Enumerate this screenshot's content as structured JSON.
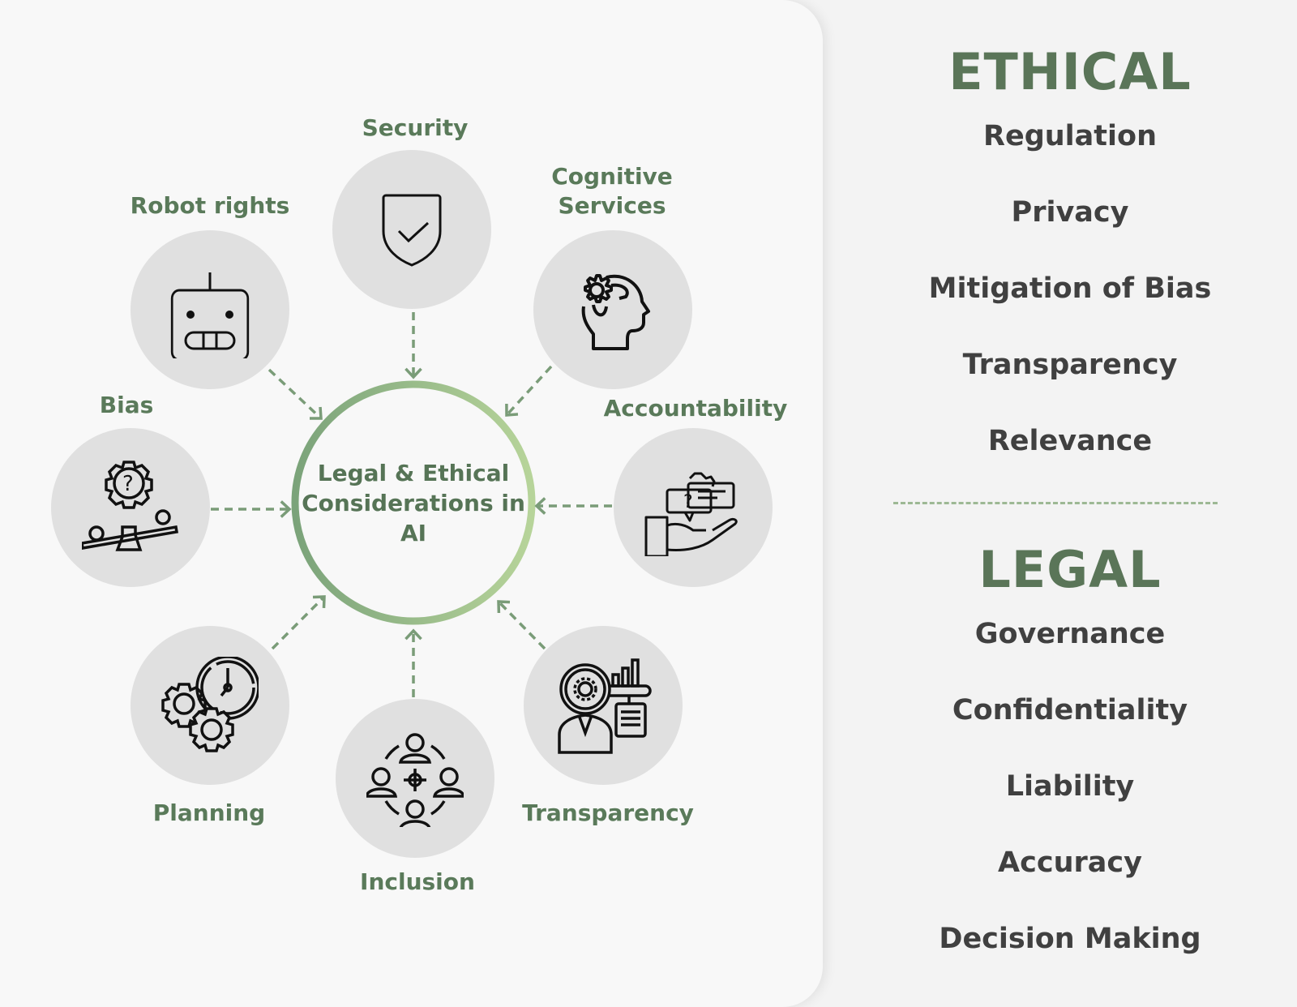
{
  "diagram": {
    "center": {
      "label": "Legal & Ethical Considerations in AI"
    },
    "nodes": [
      {
        "id": "security",
        "label": "Security",
        "icon": "shield-check-icon"
      },
      {
        "id": "cognitive",
        "label": "Cognitive Services",
        "label_lines": [
          "Cognitive",
          "Services"
        ],
        "icon": "head-gear-icon"
      },
      {
        "id": "accountability",
        "label": "Accountability",
        "icon": "hand-speech-bubbles-icon"
      },
      {
        "id": "transparency",
        "label": "Transparency",
        "icon": "magnifier-person-chart-icon"
      },
      {
        "id": "inclusion",
        "label": "Inclusion",
        "icon": "people-circle-target-icon"
      },
      {
        "id": "planning",
        "label": "Planning",
        "icon": "gears-clock-icon"
      },
      {
        "id": "bias",
        "label": "Bias",
        "icon": "gear-question-seesaw-icon"
      },
      {
        "id": "robot",
        "label": "Robot rights",
        "icon": "robot-face-icon"
      }
    ],
    "colors": {
      "accent": "#5a7a5a",
      "ring_start": "#7ba37a",
      "ring_end": "#b7d49a",
      "node_bg": "#e0e0e0",
      "arrow": "#7a9c78"
    }
  },
  "ethical": {
    "title": "ETHICAL",
    "items": [
      "Regulation",
      "Privacy",
      "Mitigation of Bias",
      "Transparency",
      "Relevance"
    ]
  },
  "legal": {
    "title": "LEGAL",
    "items": [
      "Governance",
      "Confidentiality",
      "Liability",
      "Accuracy",
      "Decision Making"
    ]
  }
}
